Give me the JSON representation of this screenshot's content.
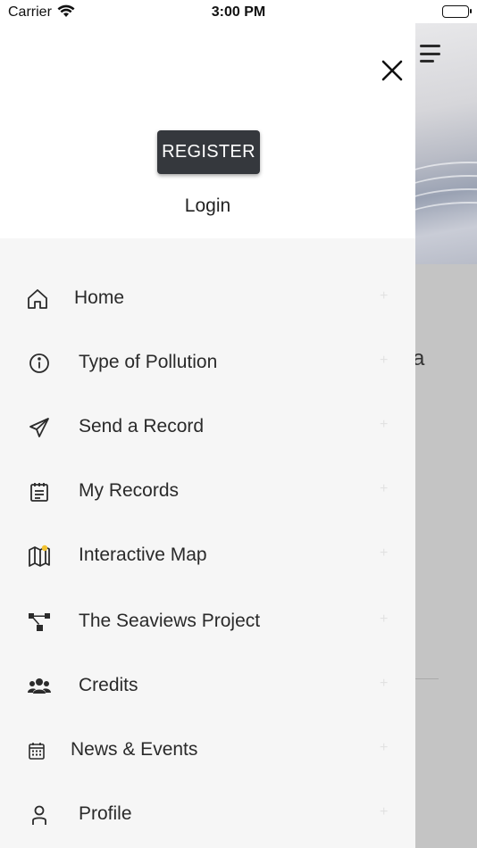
{
  "status_bar": {
    "carrier": "Carrier",
    "time": "3:00 PM"
  },
  "drawer": {
    "register_label": "REGISTER",
    "login_label": "Login",
    "menu": [
      {
        "label": "Home",
        "icon": "home-icon"
      },
      {
        "label": "Type of Pollution",
        "icon": "info-icon"
      },
      {
        "label": "Send a Record",
        "icon": "paper-plane-icon"
      },
      {
        "label": "My Records",
        "icon": "notepad-icon"
      },
      {
        "label": "Interactive Map",
        "icon": "map-icon"
      },
      {
        "label": "The Seaviews Project",
        "icon": "sitemap-icon"
      },
      {
        "label": "Credits",
        "icon": "users-icon"
      },
      {
        "label": "News & Events",
        "icon": "calendar-icon"
      },
      {
        "label": "Profile",
        "icon": "person-icon"
      }
    ],
    "expand_glyph": "+"
  },
  "background": {
    "partial_letter": "a"
  },
  "colors": {
    "drawer_bg": "#f6f6f6",
    "header_bg": "#ffffff",
    "button_bg": "#35383d",
    "overlay": "#c4c4c4"
  }
}
